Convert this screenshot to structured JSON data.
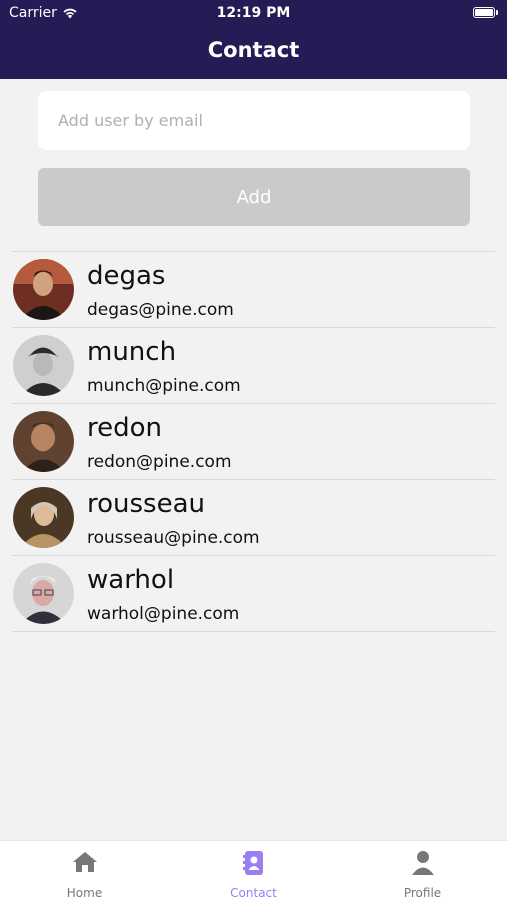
{
  "status_bar": {
    "carrier": "Carrier",
    "time": "12:19 PM"
  },
  "header": {
    "title": "Contact"
  },
  "add_user": {
    "placeholder": "Add user by email",
    "value": "",
    "button_label": "Add"
  },
  "contacts": [
    {
      "name": "degas",
      "email": "degas@pine.com"
    },
    {
      "name": "munch",
      "email": "munch@pine.com"
    },
    {
      "name": "redon",
      "email": "redon@pine.com"
    },
    {
      "name": "rousseau",
      "email": "rousseau@pine.com"
    },
    {
      "name": "warhol",
      "email": "warhol@pine.com"
    }
  ],
  "tabs": [
    {
      "label": "Home",
      "icon": "home-icon",
      "active": false
    },
    {
      "label": "Contact",
      "icon": "contact-book-icon",
      "active": true
    },
    {
      "label": "Profile",
      "icon": "person-icon",
      "active": false
    }
  ],
  "colors": {
    "header_background": "#231c55",
    "active_tab": "#9b7ef0",
    "inactive_tab": "#777777",
    "disabled_button": "#cacaca"
  }
}
